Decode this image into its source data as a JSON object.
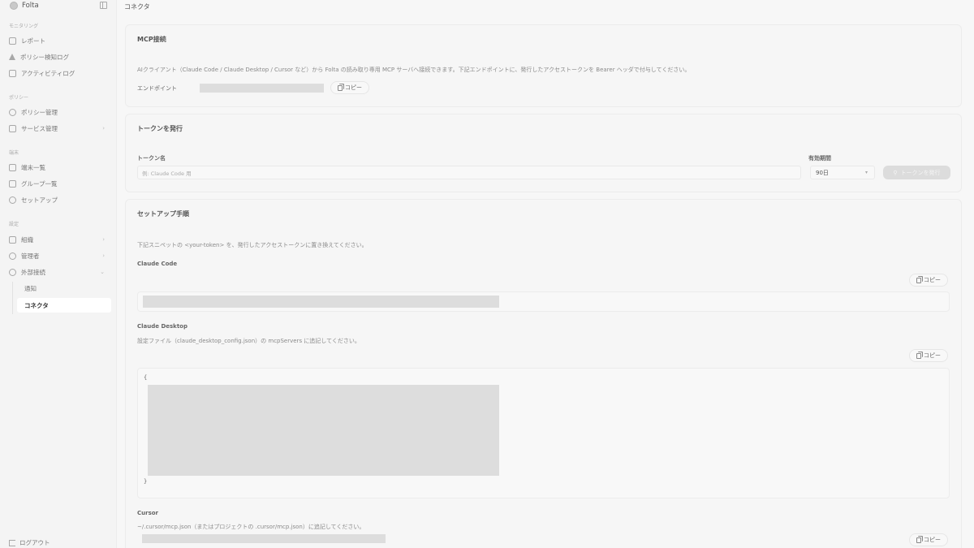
{
  "app": {
    "name": "Folta"
  },
  "sidebar": {
    "sections": [
      {
        "label": "モニタリング",
        "items": [
          {
            "label": "レポート",
            "icon": "document-icon"
          },
          {
            "label": "ポリシー検知ログ",
            "icon": "warning-icon"
          },
          {
            "label": "アクティビティログ",
            "icon": "clipboard-icon"
          }
        ]
      },
      {
        "label": "ポリシー",
        "items": [
          {
            "label": "ポリシー管理",
            "icon": "shield-icon"
          },
          {
            "label": "サービス管理",
            "icon": "server-icon"
          }
        ]
      },
      {
        "label": "端末",
        "items": [
          {
            "label": "端末一覧",
            "icon": "monitor-icon"
          },
          {
            "label": "グループ一覧",
            "icon": "folder-icon"
          },
          {
            "label": "セットアップ",
            "icon": "wrench-icon"
          }
        ]
      },
      {
        "label": "設定",
        "items": [
          {
            "label": "組織",
            "icon": "building-icon"
          },
          {
            "label": "管理者",
            "icon": "users-icon"
          },
          {
            "label": "外部接続",
            "icon": "plug-icon"
          }
        ]
      }
    ],
    "sub_items": [
      {
        "label": "通知"
      },
      {
        "label": "コネクタ"
      }
    ],
    "logout_label": "ログアウト"
  },
  "page": {
    "title": "コネクタ"
  },
  "mcp": {
    "title": "MCP接続",
    "description": "AIクライアント（Claude Code / Claude Desktop / Cursor など）から Folta の読み取り専用 MCP サーバへ接続できます。下記エンドポイントに、発行したアクセストークンを Bearer ヘッダで付与してください。",
    "endpoint_label": "エンドポイント",
    "copy_label": "コピー"
  },
  "token": {
    "title": "トークンを発行",
    "name_label": "トークン名",
    "name_placeholder": "例: Claude Code 用",
    "expiry_label": "有効期間",
    "expiry_value": "90日",
    "issue_label": "トークンを発行"
  },
  "setup": {
    "title": "セットアップ手順",
    "intro": "下記スニペットの <your-token> を、発行したアクセストークンに置き換えてください。",
    "claude_code": {
      "title": "Claude Code",
      "copy_label": "コピー"
    },
    "claude_desktop": {
      "title": "Claude Desktop",
      "note": "設定ファイル（claude_desktop_config.json）の mcpServers に追記してください。",
      "copy_label": "コピー",
      "open_brace": "{",
      "close_brace": "}"
    },
    "cursor": {
      "title": "Cursor",
      "note": "~/.cursor/mcp.json（またはプロジェクトの .cursor/mcp.json）に追記してください。",
      "copy_label": "コピー"
    }
  }
}
